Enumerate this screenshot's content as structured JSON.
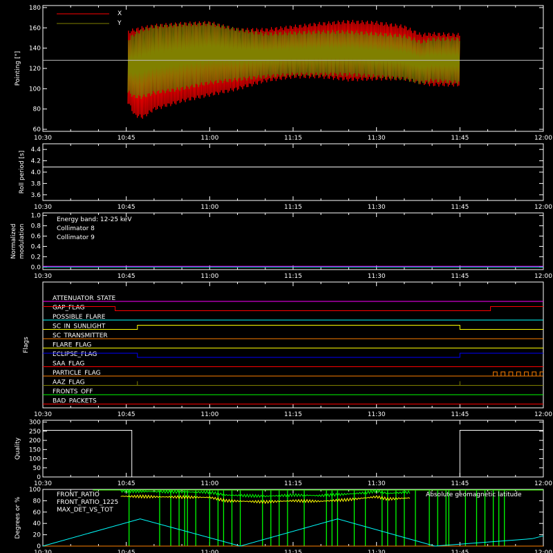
{
  "x_ticks": [
    "10:30",
    "10:45",
    "11:00",
    "11:15",
    "11:30",
    "11:45",
    "12:00"
  ],
  "x_range_min": [
    0,
    90
  ],
  "colors": {
    "background": "#000000",
    "axes": "#ffffff",
    "x_series": "#ff0000",
    "y_series": "#808000",
    "collimator8": "#00ffff",
    "collimator9": "#ff00ff",
    "front_ratio": "#ffff00",
    "front_ratio_1225": "#00ff00",
    "max_det": "#ff8000",
    "geomag": "#00ffff"
  },
  "chart_data": [
    {
      "type": "area",
      "id": "pointing",
      "ylabel": "Pointing [\"]",
      "ylim": [
        58,
        182
      ],
      "yticks": [
        "60",
        "80",
        "100",
        "120",
        "140",
        "160",
        "180"
      ],
      "legend": [
        "X",
        "Y"
      ],
      "reference_line": 128,
      "series": [
        {
          "name": "X",
          "x": [
            15.3,
            16.5,
            18,
            20,
            25,
            30,
            35,
            40,
            45,
            50,
            55,
            60,
            65,
            68,
            70,
            75
          ],
          "upper": [
            158,
            160,
            162,
            164,
            166,
            167,
            160,
            160,
            163,
            166,
            168,
            167,
            163,
            155,
            156,
            155
          ],
          "lower": [
            85,
            72,
            70,
            78,
            86,
            92,
            98,
            106,
            110,
            110,
            107,
            108,
            108,
            104,
            102,
            102
          ]
        },
        {
          "name": "Y",
          "x": [
            15.3,
            16.5,
            18,
            20,
            25,
            30,
            35,
            40,
            45,
            50,
            55,
            60,
            65,
            68,
            70,
            75
          ],
          "upper": [
            150,
            156,
            160,
            163,
            165,
            166,
            160,
            156,
            157,
            158,
            158,
            156,
            154,
            148,
            151,
            151
          ],
          "lower": [
            95,
            90,
            90,
            94,
            98,
            104,
            107,
            110,
            112,
            112,
            112,
            110,
            108,
            104,
            106,
            104
          ]
        }
      ]
    },
    {
      "type": "line",
      "id": "roll",
      "ylabel": "Roll period [s]",
      "ylim": [
        3.5,
        4.5
      ],
      "yticks": [
        "3.6",
        "3.8",
        "4.0",
        "4.2",
        "4.4"
      ],
      "series": [
        {
          "name": "roll",
          "x": [
            0,
            90
          ],
          "y": [
            4.09,
            4.09
          ]
        }
      ]
    },
    {
      "type": "line",
      "id": "modulation",
      "ylabel": "Normalized modulation",
      "ylim": [
        -0.05,
        1.05
      ],
      "yticks": [
        "0.0",
        "0.2",
        "0.4",
        "0.6",
        "0.8",
        "1.0"
      ],
      "legend": [
        "Energy band: 12-25 keV",
        "Collimator 8",
        "Collimator 9"
      ],
      "series": [
        {
          "name": "Collimator 8",
          "x": [
            0,
            90
          ],
          "y": [
            0,
            0
          ]
        },
        {
          "name": "Collimator 9",
          "x": [
            0,
            90
          ],
          "y": [
            0,
            0
          ]
        }
      ]
    },
    {
      "type": "line",
      "id": "flags",
      "ylabel": "Flags",
      "flags": [
        {
          "name": "ATTENUATOR_STATE",
          "color": "#ff00ff",
          "changes": []
        },
        {
          "name": "GAP_FLAG",
          "color": "#ff0000",
          "changes": [
            [
              13,
              1
            ],
            [
              13,
              0
            ],
            [
              80.5,
              0
            ],
            [
              80.5,
              1
            ]
          ]
        },
        {
          "name": "POSSIBLE_FLARE",
          "color": "#00ffff",
          "changes": []
        },
        {
          "name": "SC_IN_SUNLIGHT",
          "color": "#ffff00",
          "changes": [
            [
              0,
              0
            ],
            [
              17,
              0
            ],
            [
              17,
              1
            ],
            [
              75,
              1
            ],
            [
              75,
              0
            ]
          ]
        },
        {
          "name": "SC_TRANSMITTER",
          "color": "#ff8000",
          "changes": []
        },
        {
          "name": "FLARE_FLAG",
          "color": "#ffff00",
          "changes": []
        },
        {
          "name": "ECLIPSE_FLAG",
          "color": "#0000ff",
          "changes": [
            [
              0,
              1
            ],
            [
              17,
              1
            ],
            [
              17,
              0
            ],
            [
              75,
              0
            ],
            [
              75,
              1
            ]
          ]
        },
        {
          "name": "SAA_FLAG",
          "color": "#ff0000",
          "changes": []
        },
        {
          "name": "PARTICLE_FLAG",
          "color": "#ff8000",
          "changes": []
        },
        {
          "name": "AAZ_FLAG",
          "color": "#808000",
          "changes": []
        },
        {
          "name": "FRONTS_OFF",
          "color": "#00ff00",
          "changes": []
        },
        {
          "name": "BAD_PACKETS",
          "color": "#ff0000",
          "changes": []
        }
      ]
    },
    {
      "type": "line",
      "id": "quality",
      "ylabel": "Quality",
      "ylim": [
        0,
        310
      ],
      "yticks": [
        "0",
        "50",
        "100",
        "150",
        "200",
        "250",
        "300"
      ],
      "series": [
        {
          "name": "quality",
          "x": [
            0,
            16,
            16,
            75,
            75,
            90
          ],
          "y": [
            255,
            255,
            0,
            0,
            255,
            255
          ]
        }
      ]
    },
    {
      "type": "line",
      "id": "ratios",
      "ylabel": "Degrees or %",
      "ylim": [
        0,
        100
      ],
      "yticks": [
        "0",
        "20",
        "40",
        "60",
        "80",
        "100"
      ],
      "legend": [
        "FRONT_RATIO",
        "FRONT_RATIO_1225",
        "MAX_DET_VS_TOT",
        "Absolute geomagnetic latitude"
      ],
      "series": [
        {
          "name": "FRONT_RATIO",
          "x": [
            14,
            20,
            30,
            33,
            40,
            45,
            50,
            55,
            58,
            60,
            62,
            66
          ],
          "y": [
            88,
            87,
            86,
            80,
            78,
            80,
            79,
            82,
            85,
            87,
            83,
            85
          ]
        },
        {
          "name": "FRONT_RATIO_1225",
          "x": [
            14,
            20,
            30,
            33,
            40,
            45,
            50,
            55,
            58,
            60,
            62,
            66
          ],
          "y": [
            97,
            96,
            95,
            90,
            88,
            90,
            89,
            92,
            94,
            97,
            93,
            95
          ]
        },
        {
          "name": "MAX_DET_VS_TOT",
          "x": [
            0,
            90
          ],
          "y": [
            0,
            0
          ]
        },
        {
          "name": "Absolute geomagnetic latitude",
          "x": [
            0,
            17.5,
            35.5,
            53,
            70.5,
            88,
            90
          ],
          "y": [
            0,
            48,
            0,
            48,
            0,
            13,
            18
          ]
        }
      ],
      "green_drops": [
        15.5,
        21,
        23,
        24.5,
        25.5,
        26,
        27.5,
        30,
        31.5,
        32.5,
        34,
        35.5,
        39.5,
        41,
        42.5,
        44,
        47,
        51,
        52,
        53,
        56,
        58,
        61,
        62,
        63.5,
        65,
        67,
        69.5,
        71,
        72.5,
        73,
        76,
        78,
        79.5,
        81,
        82,
        83
      ]
    }
  ]
}
